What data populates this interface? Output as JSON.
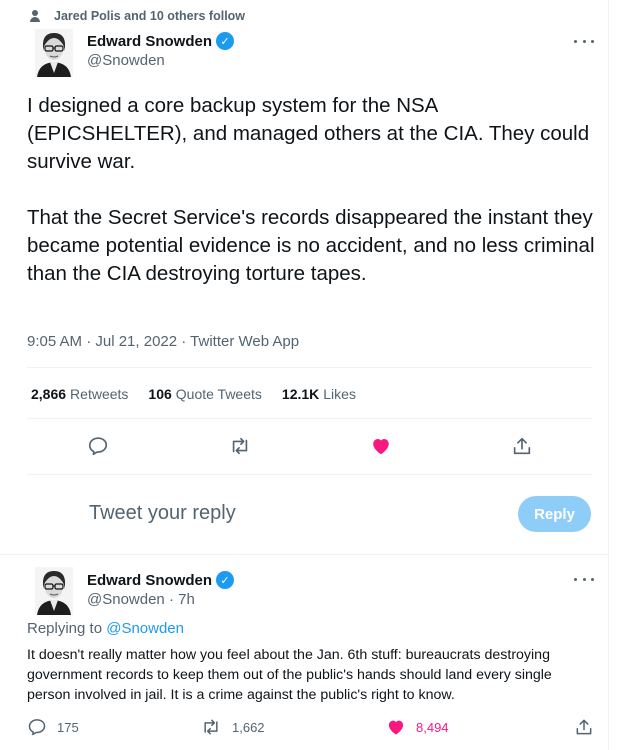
{
  "social_context": "Jared Polis and 10 others follow",
  "main_tweet": {
    "name": "Edward Snowden",
    "handle": "@Snowden",
    "text": [
      "I designed a core backup system for the NSA (EPICSHELTER), and managed others at the CIA. They could survive war.",
      "That the Secret Service's records disappeared the instant they became potential evidence is no accident, and no less criminal than the CIA destroying torture tapes."
    ],
    "meta": "9:05 AM · Jul 21, 2022 · Twitter Web App",
    "stats": [
      {
        "count": "2,866",
        "label": "Retweets"
      },
      {
        "count": "106",
        "label": "Quote Tweets"
      },
      {
        "count": "12.1K",
        "label": "Likes"
      }
    ],
    "actions": [
      "reply-icon",
      "retweet-icon",
      "like-icon",
      "share-icon"
    ],
    "liked": true
  },
  "composer": {
    "placeholder": "Tweet your reply",
    "button_label": "Reply"
  },
  "reply_tweet": {
    "name": "Edward Snowden",
    "handle_time": "@Snowden · 7h",
    "replying_prefix": "Replying to",
    "replying_to": "@Snowden",
    "text": "It doesn't really matter how you feel about the Jan. 6th stuff: bureaucrats destroying government records to keep them out of the public's hands should land every single person involved in jail. It is a crime against the public's right to know.",
    "reply_count": "175",
    "retweet_count": "1,662",
    "like_count": "8,494"
  },
  "colors": {
    "accent": "#1d9bf0",
    "like": "#f91880",
    "secondary_text": "#536471",
    "reply_button_disabled": "#8ecdf8"
  }
}
